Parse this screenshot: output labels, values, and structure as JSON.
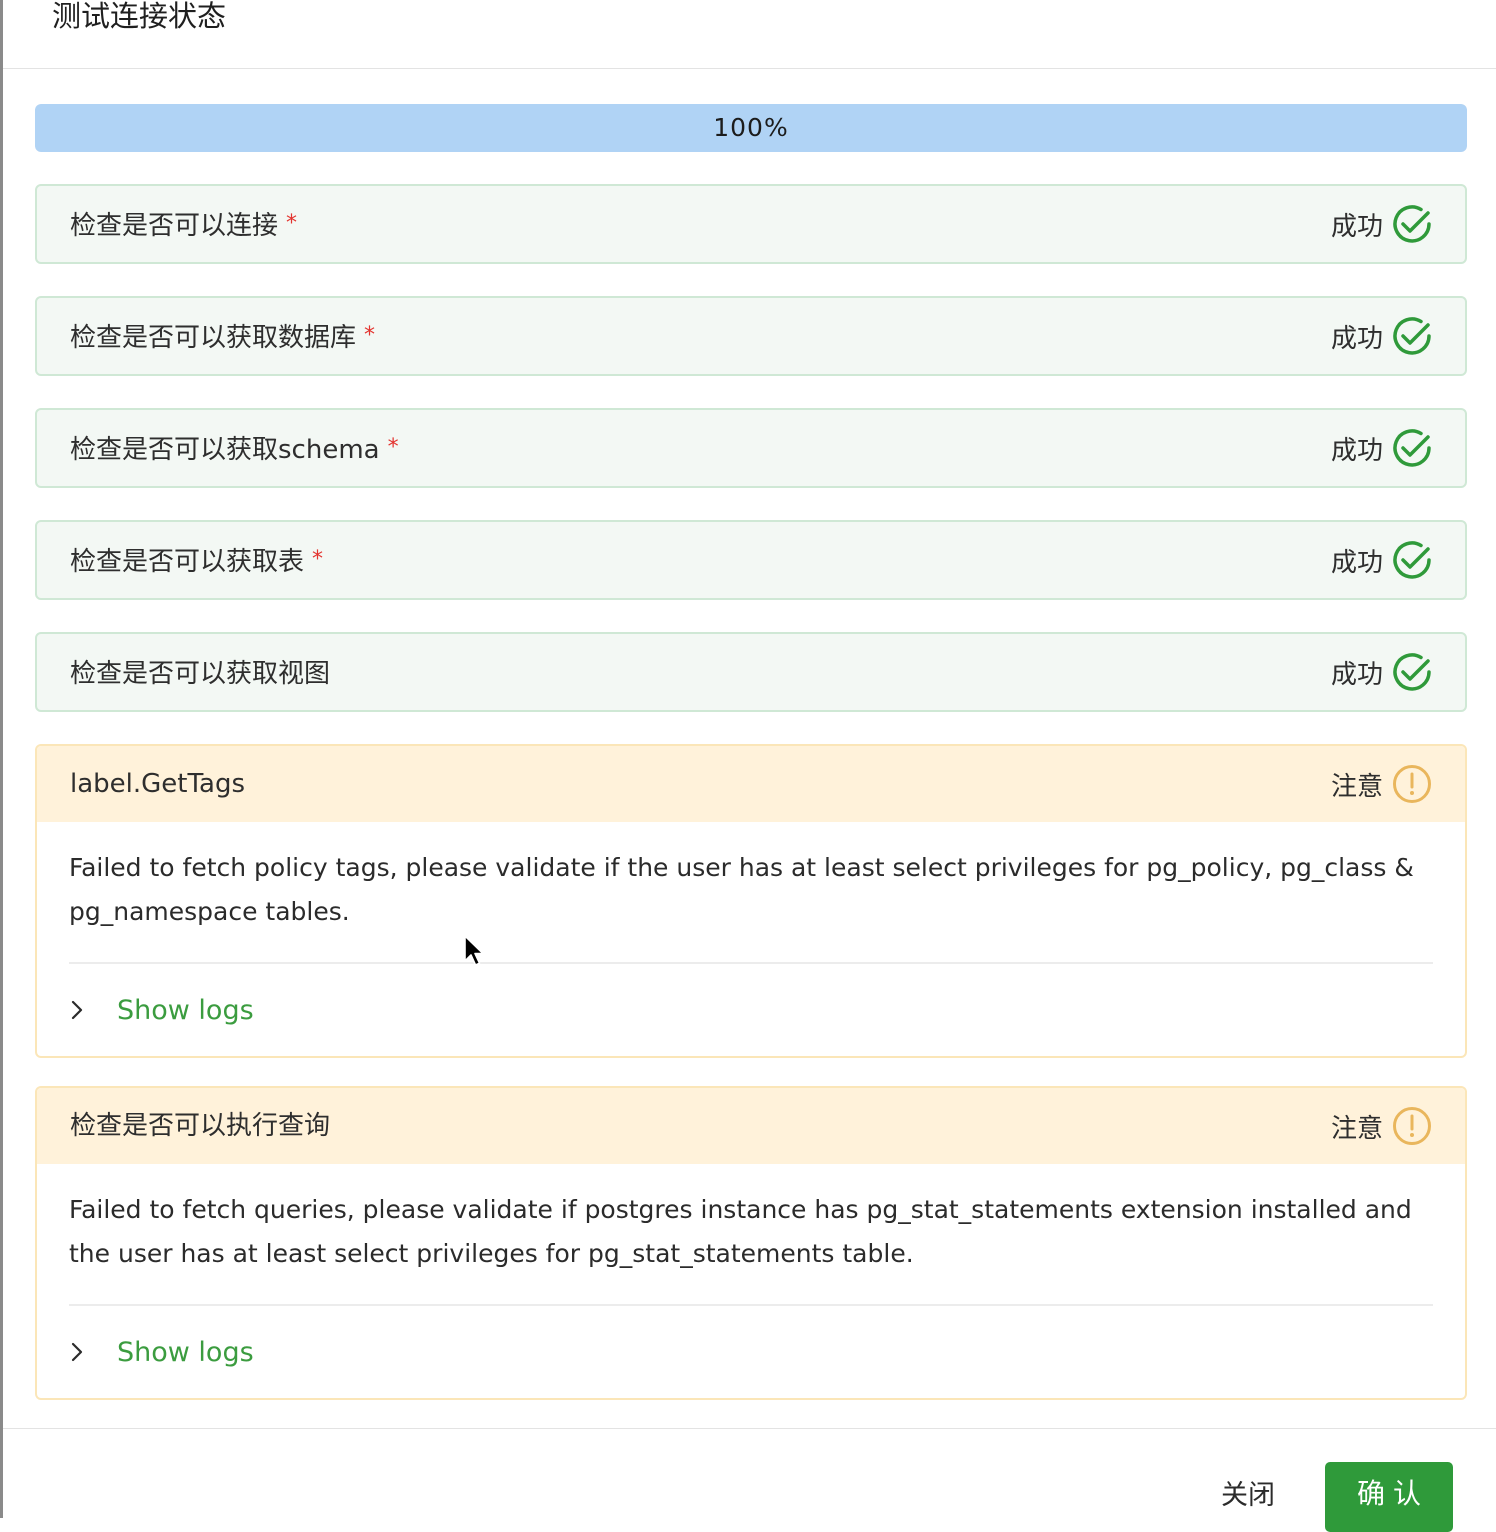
{
  "dialog": {
    "title": "测试连接状态"
  },
  "progress": {
    "percent": 100,
    "label": "100%"
  },
  "checks": [
    {
      "label": "检查是否可以连接",
      "required": "*",
      "status": "成功"
    },
    {
      "label": "检查是否可以获取数据库",
      "required": "*",
      "status": "成功"
    },
    {
      "label": "检查是否可以获取schema",
      "required": "*",
      "status": "成功"
    },
    {
      "label": "检查是否可以获取表",
      "required": "*",
      "status": "成功"
    },
    {
      "label": "检查是否可以获取视图",
      "required": "",
      "status": "成功"
    }
  ],
  "warnings": [
    {
      "label": "label.GetTags",
      "status": "注意",
      "message": "Failed to fetch policy tags, please validate if the user has at least select privileges for pg_policy, pg_class & pg_namespace tables.",
      "logs_label": "Show logs"
    },
    {
      "label": "检查是否可以执行查询",
      "status": "注意",
      "message": "Failed to fetch queries, please validate if postgres instance has pg_stat_statements extension installed and the user has at least select privileges for pg_stat_statements table.",
      "logs_label": "Show logs"
    }
  ],
  "footer": {
    "close_label": "关闭",
    "confirm_label": "确认"
  },
  "colors": {
    "success": "#2f9a3a",
    "warning": "#e9b65c",
    "progress": "#b0d3f5",
    "link": "#3b9c3f"
  },
  "icons": {
    "success": "check-circle-icon",
    "warning": "exclamation-circle-icon",
    "expand": "chevron-right-icon"
  }
}
